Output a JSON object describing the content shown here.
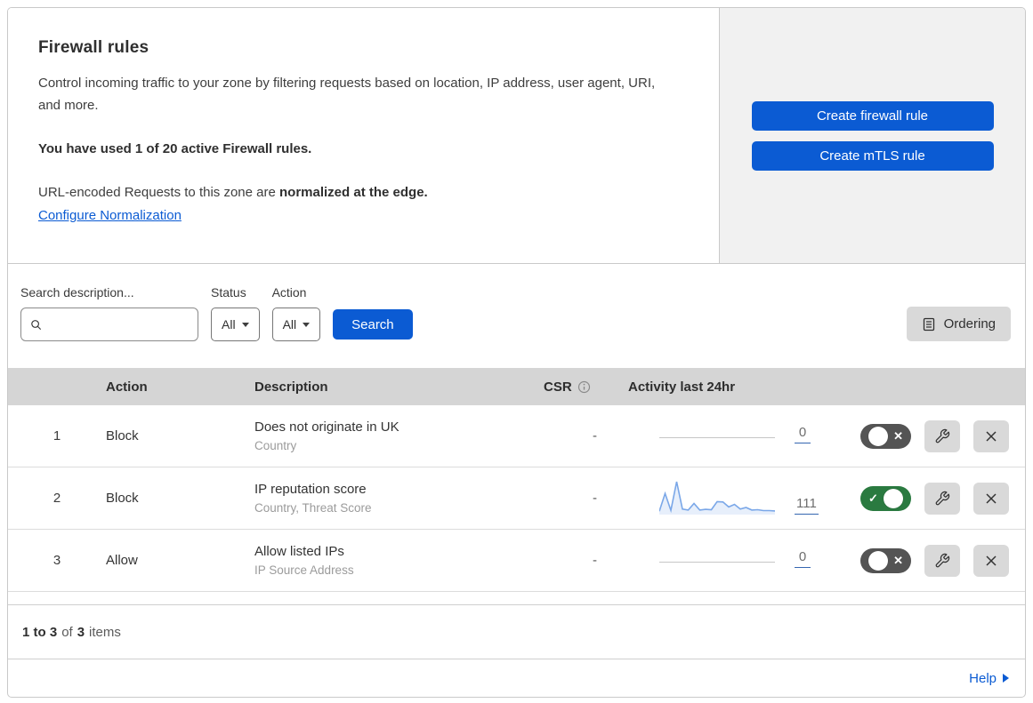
{
  "header": {
    "title": "Firewall rules",
    "description": "Control incoming traffic to your zone by filtering requests based on location, IP address, user agent, URI, and more.",
    "usage_line": "You have used 1 of 20 active Firewall rules.",
    "normalization_text": "URL-encoded Requests to this zone are ",
    "normalization_bold": "normalized at the edge.",
    "normalization_link": "Configure Normalization",
    "create_firewall_button": "Create firewall rule",
    "create_mtls_button": "Create mTLS rule"
  },
  "filters": {
    "search_label": "Search description...",
    "search_value": "",
    "status_label": "Status",
    "status_value": "All",
    "action_label": "Action",
    "action_value": "All",
    "search_button": "Search",
    "ordering_button": "Ordering"
  },
  "table": {
    "columns": {
      "action": "Action",
      "description": "Description",
      "csr": "CSR",
      "activity": "Activity last 24hr"
    },
    "rows": [
      {
        "index": "1",
        "action": "Block",
        "description": "Does not originate in UK",
        "fields": "Country",
        "csr": "-",
        "count": "0",
        "enabled": false,
        "has_chart": false
      },
      {
        "index": "2",
        "action": "Block",
        "description": "IP reputation score",
        "fields": "Country, Threat Score",
        "csr": "-",
        "count": "111",
        "enabled": true,
        "has_chart": true
      },
      {
        "index": "3",
        "action": "Allow",
        "description": "Allow listed IPs",
        "fields": "IP Source Address",
        "csr": "-",
        "count": "0",
        "enabled": false,
        "has_chart": false
      }
    ],
    "summary": {
      "range": "1 to 3",
      "of_word": "of",
      "total": "3",
      "items_word": "items"
    }
  },
  "footer": {
    "help_label": "Help"
  },
  "icons": {
    "toggle_on_mark": "✓",
    "toggle_off_mark": "✕"
  },
  "chart_data": {
    "type": "area",
    "title": "Activity last 24hr sparkline (rule 2: IP reputation score)",
    "x_description": "time buckets over last 24 hours",
    "values": [
      5,
      62,
      8,
      100,
      12,
      9,
      30,
      9,
      11,
      10,
      36,
      35,
      19,
      27,
      12,
      17,
      9,
      10,
      7,
      7,
      6
    ],
    "ylim": [
      0,
      100
    ],
    "total_events": 111,
    "line_color": "#7aa7e8",
    "fill_color": "rgba(122,167,232,0.18)",
    "grid": false,
    "legend": false
  },
  "colors": {
    "accent_blue": "#0b5bd3",
    "toggle_on_green": "#2a7a40",
    "toggle_off_gray": "#545454",
    "table_header_bg": "#d5d5d5",
    "side_panel_bg": "#f1f1f1",
    "gray_button_bg": "#d9d9d9"
  }
}
